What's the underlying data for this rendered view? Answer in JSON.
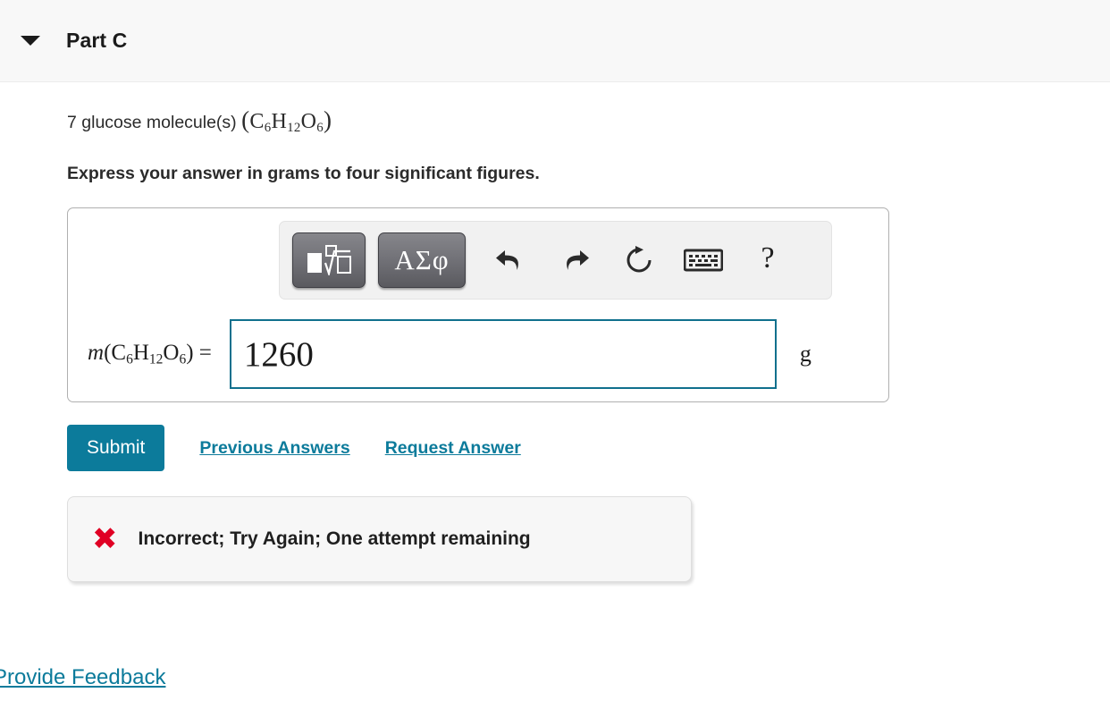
{
  "header": {
    "caret_icon": "caret-down-icon",
    "title": "Part C"
  },
  "question": {
    "prefix": "7 glucose molecule(s) ",
    "formula_open": "(",
    "formula": {
      "el1": "C",
      "sub1": "6",
      "el2": "H",
      "sub2": "12",
      "el3": "O",
      "sub3": "6"
    },
    "formula_close": ")",
    "instruction": "Express your answer in grams to four significant figures."
  },
  "toolbar": {
    "template_button_label": "square-root-template",
    "greek_button_label": "ΑΣφ",
    "undo_label": "undo-icon",
    "redo_label": "redo-icon",
    "reset_label": "reset-icon",
    "keyboard_label": "keyboard-icon",
    "help_label": "?"
  },
  "answer": {
    "label_m": "m",
    "label_open": "(",
    "label_el1": "C",
    "label_sub1": "6",
    "label_el2": "H",
    "label_sub2": "12",
    "label_el3": "O",
    "label_sub3": "6",
    "label_close": ")",
    "label_equals": " =",
    "value": "1260",
    "placeholder": "",
    "unit": "g"
  },
  "actions": {
    "submit_label": "Submit",
    "previous_answers_label": "Previous Answers",
    "request_answer_label": "Request Answer"
  },
  "feedback": {
    "icon": "x-mark-icon",
    "icon_glyph": "✖",
    "message": "Incorrect; Try Again; One attempt remaining"
  },
  "footer": {
    "provide_feedback_label": "Provide Feedback"
  },
  "colors": {
    "accent_teal": "#0c7b9b",
    "error_red": "#e00024",
    "input_border": "#10708d",
    "header_bg": "#f8f8f8"
  }
}
